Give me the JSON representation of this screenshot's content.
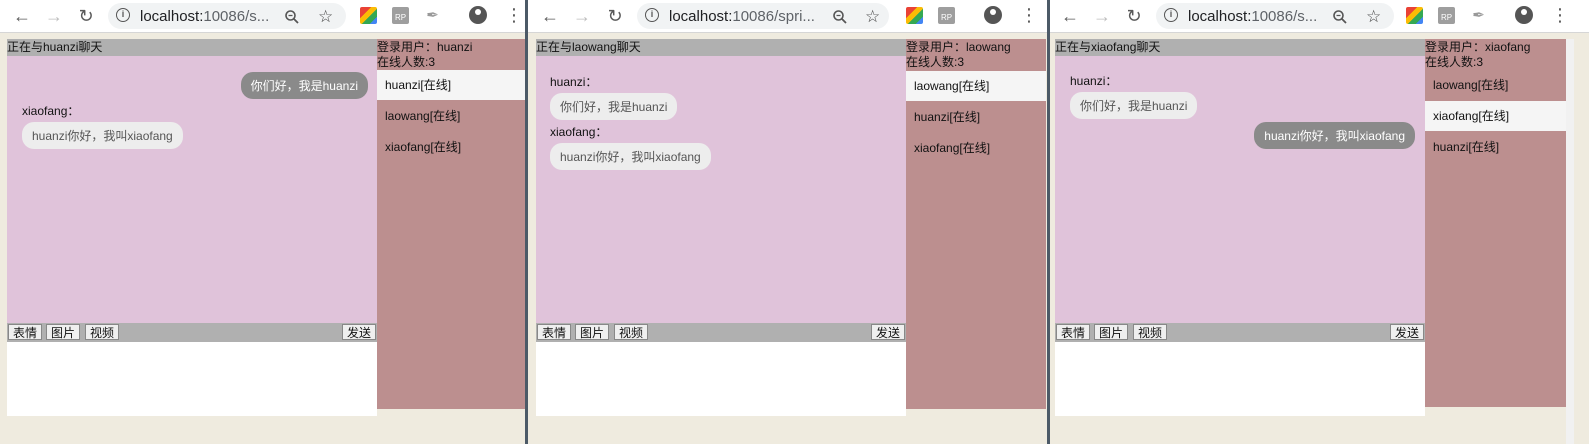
{
  "windows": [
    {
      "url_host": "localhost:",
      "url_rest": "10086/s...",
      "chat_title": "正在与huanzi聊天",
      "login_label": "登录用户：huanzi",
      "online_count": "在线人数:3",
      "users": [
        "huanzi[在线]",
        "laowang[在线]",
        "xiaofang[在线]"
      ],
      "active_user": 0,
      "messages": [
        {
          "side": "self",
          "name": "",
          "text": "你们好，我是huanzi"
        },
        {
          "side": "other",
          "name": "xiaofang：",
          "text": "huanzi你好，我叫xiaofang"
        }
      ]
    },
    {
      "url_host": "localhost:",
      "url_rest": "10086/spri...",
      "chat_title": "正在与laowang聊天",
      "login_label": "登录用户：laowang",
      "online_count": "在线人数:3",
      "users": [
        "laowang[在线]",
        "huanzi[在线]",
        "xiaofang[在线]"
      ],
      "active_user": 0,
      "messages": [
        {
          "side": "other",
          "name": "huanzi：",
          "text": "你们好，我是huanzi"
        },
        {
          "side": "other",
          "name": "xiaofang：",
          "text": "huanzi你好，我叫xiaofang"
        }
      ]
    },
    {
      "url_host": "localhost:",
      "url_rest": "10086/s...",
      "chat_title": "正在与xiaofang聊天",
      "login_label": "登录用户：xiaofang",
      "online_count": "在线人数:3",
      "users": [
        "laowang[在线]",
        "xiaofang[在线]",
        "huanzi[在线]"
      ],
      "active_user": 1,
      "messages": [
        {
          "side": "other",
          "name": "huanzi：",
          "text": "你们好，我是huanzi"
        },
        {
          "side": "self",
          "name": "",
          "text": "huanzi你好，我叫xiaofang"
        }
      ]
    }
  ],
  "toolbar_buttons": {
    "emoji": "表情",
    "image": "图片",
    "video": "视频",
    "send": "发送"
  },
  "icons": {
    "back": "back-arrow-icon",
    "forward": "forward-arrow-icon",
    "reload": "reload-icon",
    "info": "info-icon",
    "zoom": "zoom-icon",
    "star": "star-icon",
    "profile": "profile-icon",
    "menu": "menu-dots-icon"
  },
  "colors": {
    "messages_bg": "#e0c3da",
    "online_bg": "#bc8f8f",
    "header_bg": "#b0b0b0",
    "self_bubble": "#8a8a8a",
    "other_bubble": "#ededed"
  }
}
